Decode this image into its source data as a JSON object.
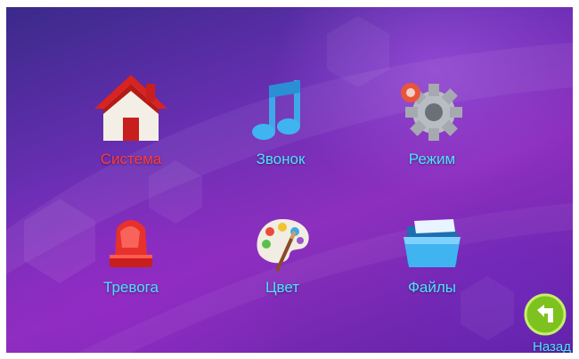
{
  "menu": {
    "items": [
      {
        "id": "system",
        "label": "Система",
        "icon": "house-icon",
        "color": "#ff3b3b"
      },
      {
        "id": "ring",
        "label": "Звонок",
        "icon": "music-note-icon",
        "color": "#4de3ff"
      },
      {
        "id": "mode",
        "label": "Режим",
        "icon": "gear-icon",
        "color": "#4de3ff"
      },
      {
        "id": "alarm",
        "label": "Тревога",
        "icon": "siren-icon",
        "color": "#4de3ff"
      },
      {
        "id": "color",
        "label": "Цвет",
        "icon": "palette-icon",
        "color": "#4de3ff"
      },
      {
        "id": "files",
        "label": "Файлы",
        "icon": "folder-icon",
        "color": "#4de3ff"
      }
    ]
  },
  "back": {
    "label": "Назад",
    "icon": "back-arrow-icon"
  },
  "colors": {
    "selected": "#ff3b3b",
    "normal": "#4de3ff"
  }
}
